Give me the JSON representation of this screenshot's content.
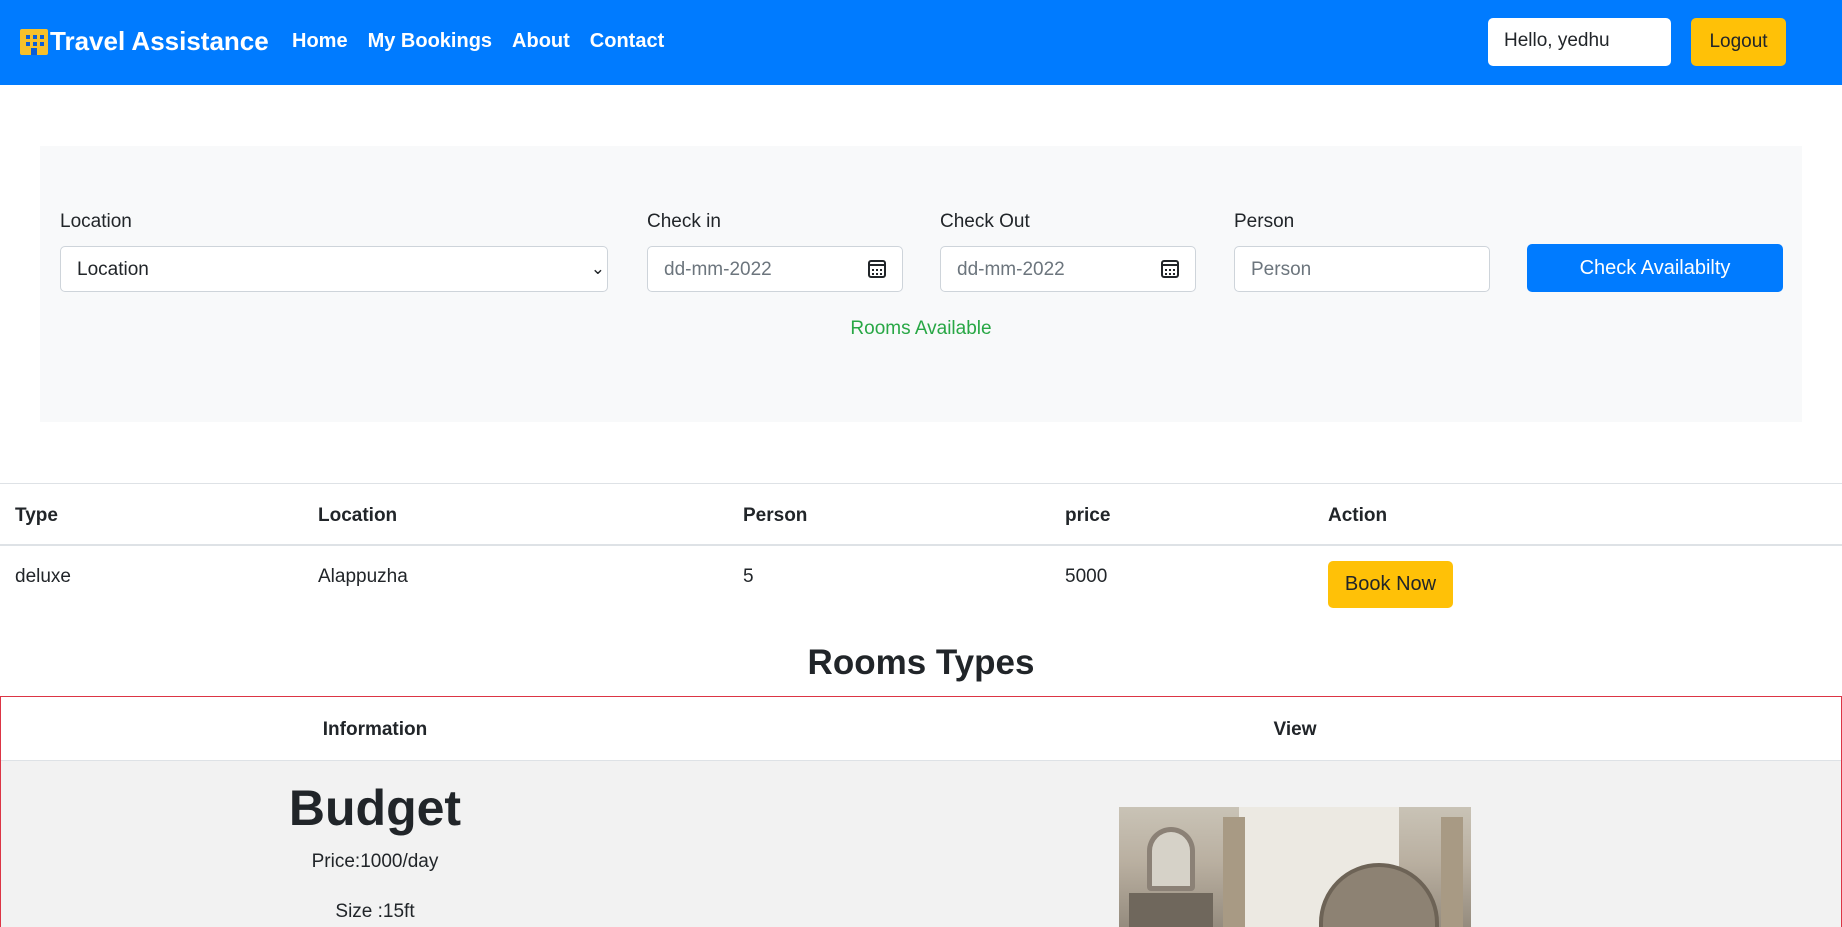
{
  "navbar": {
    "brand": "Travel Assistance",
    "links": [
      "Home",
      "My Bookings",
      "About",
      "Contact"
    ],
    "greeting": "Hello, yedhu",
    "logout_label": "Logout"
  },
  "search": {
    "location_label": "Location",
    "location_value": "Location",
    "checkin_label": "Check in",
    "checkin_value": "dd-mm-2022",
    "checkout_label": "Check Out",
    "checkout_value": "dd-mm-2022",
    "person_label": "Person",
    "person_placeholder": "Person",
    "button_label": "Check Availabilty",
    "message": "Rooms Available"
  },
  "results": {
    "headers": [
      "Type",
      "Location",
      "Person",
      "price",
      "Action"
    ],
    "rows": [
      {
        "type": "deluxe",
        "location": "Alappuzha",
        "person": "5",
        "price": "5000",
        "action": "Book Now"
      }
    ]
  },
  "room_types": {
    "title": "Rooms Types",
    "headers": [
      "Information",
      "View"
    ],
    "items": [
      {
        "name": "Budget",
        "price": "Price:1000/day",
        "size": "Size :15ft",
        "image": "bedroom-photo"
      }
    ]
  },
  "colors": {
    "primary": "#007bff",
    "warning": "#ffc107",
    "success": "#28a745",
    "panel": "#f8f9fa",
    "table_border": "#dc3545"
  }
}
